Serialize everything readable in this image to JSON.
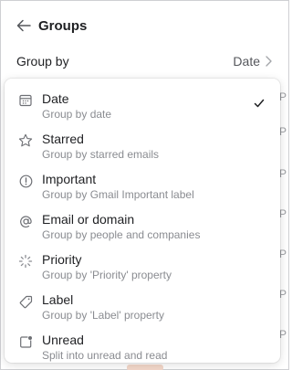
{
  "header": {
    "title": "Groups"
  },
  "group_by": {
    "label": "Group by",
    "value": "Date"
  },
  "options": [
    {
      "icon": "calendar-icon",
      "title": "Date",
      "subtitle": "Group by date",
      "selected": true
    },
    {
      "icon": "star-icon",
      "title": "Starred",
      "subtitle": "Group by starred emails",
      "selected": false
    },
    {
      "icon": "important-icon",
      "title": "Important",
      "subtitle": "Group by Gmail Important label",
      "selected": false
    },
    {
      "icon": "at-icon",
      "title": "Email or domain",
      "subtitle": "Group by people and companies",
      "selected": false
    },
    {
      "icon": "priority-icon",
      "title": "Priority",
      "subtitle": "Group by 'Priority' property",
      "selected": false
    },
    {
      "icon": "tag-icon",
      "title": "Label",
      "subtitle": "Group by 'Label' property",
      "selected": false
    },
    {
      "icon": "unread-icon",
      "title": "Unread",
      "subtitle": "Split into unread and read",
      "selected": false
    }
  ],
  "background": {
    "row_letter": "P"
  }
}
